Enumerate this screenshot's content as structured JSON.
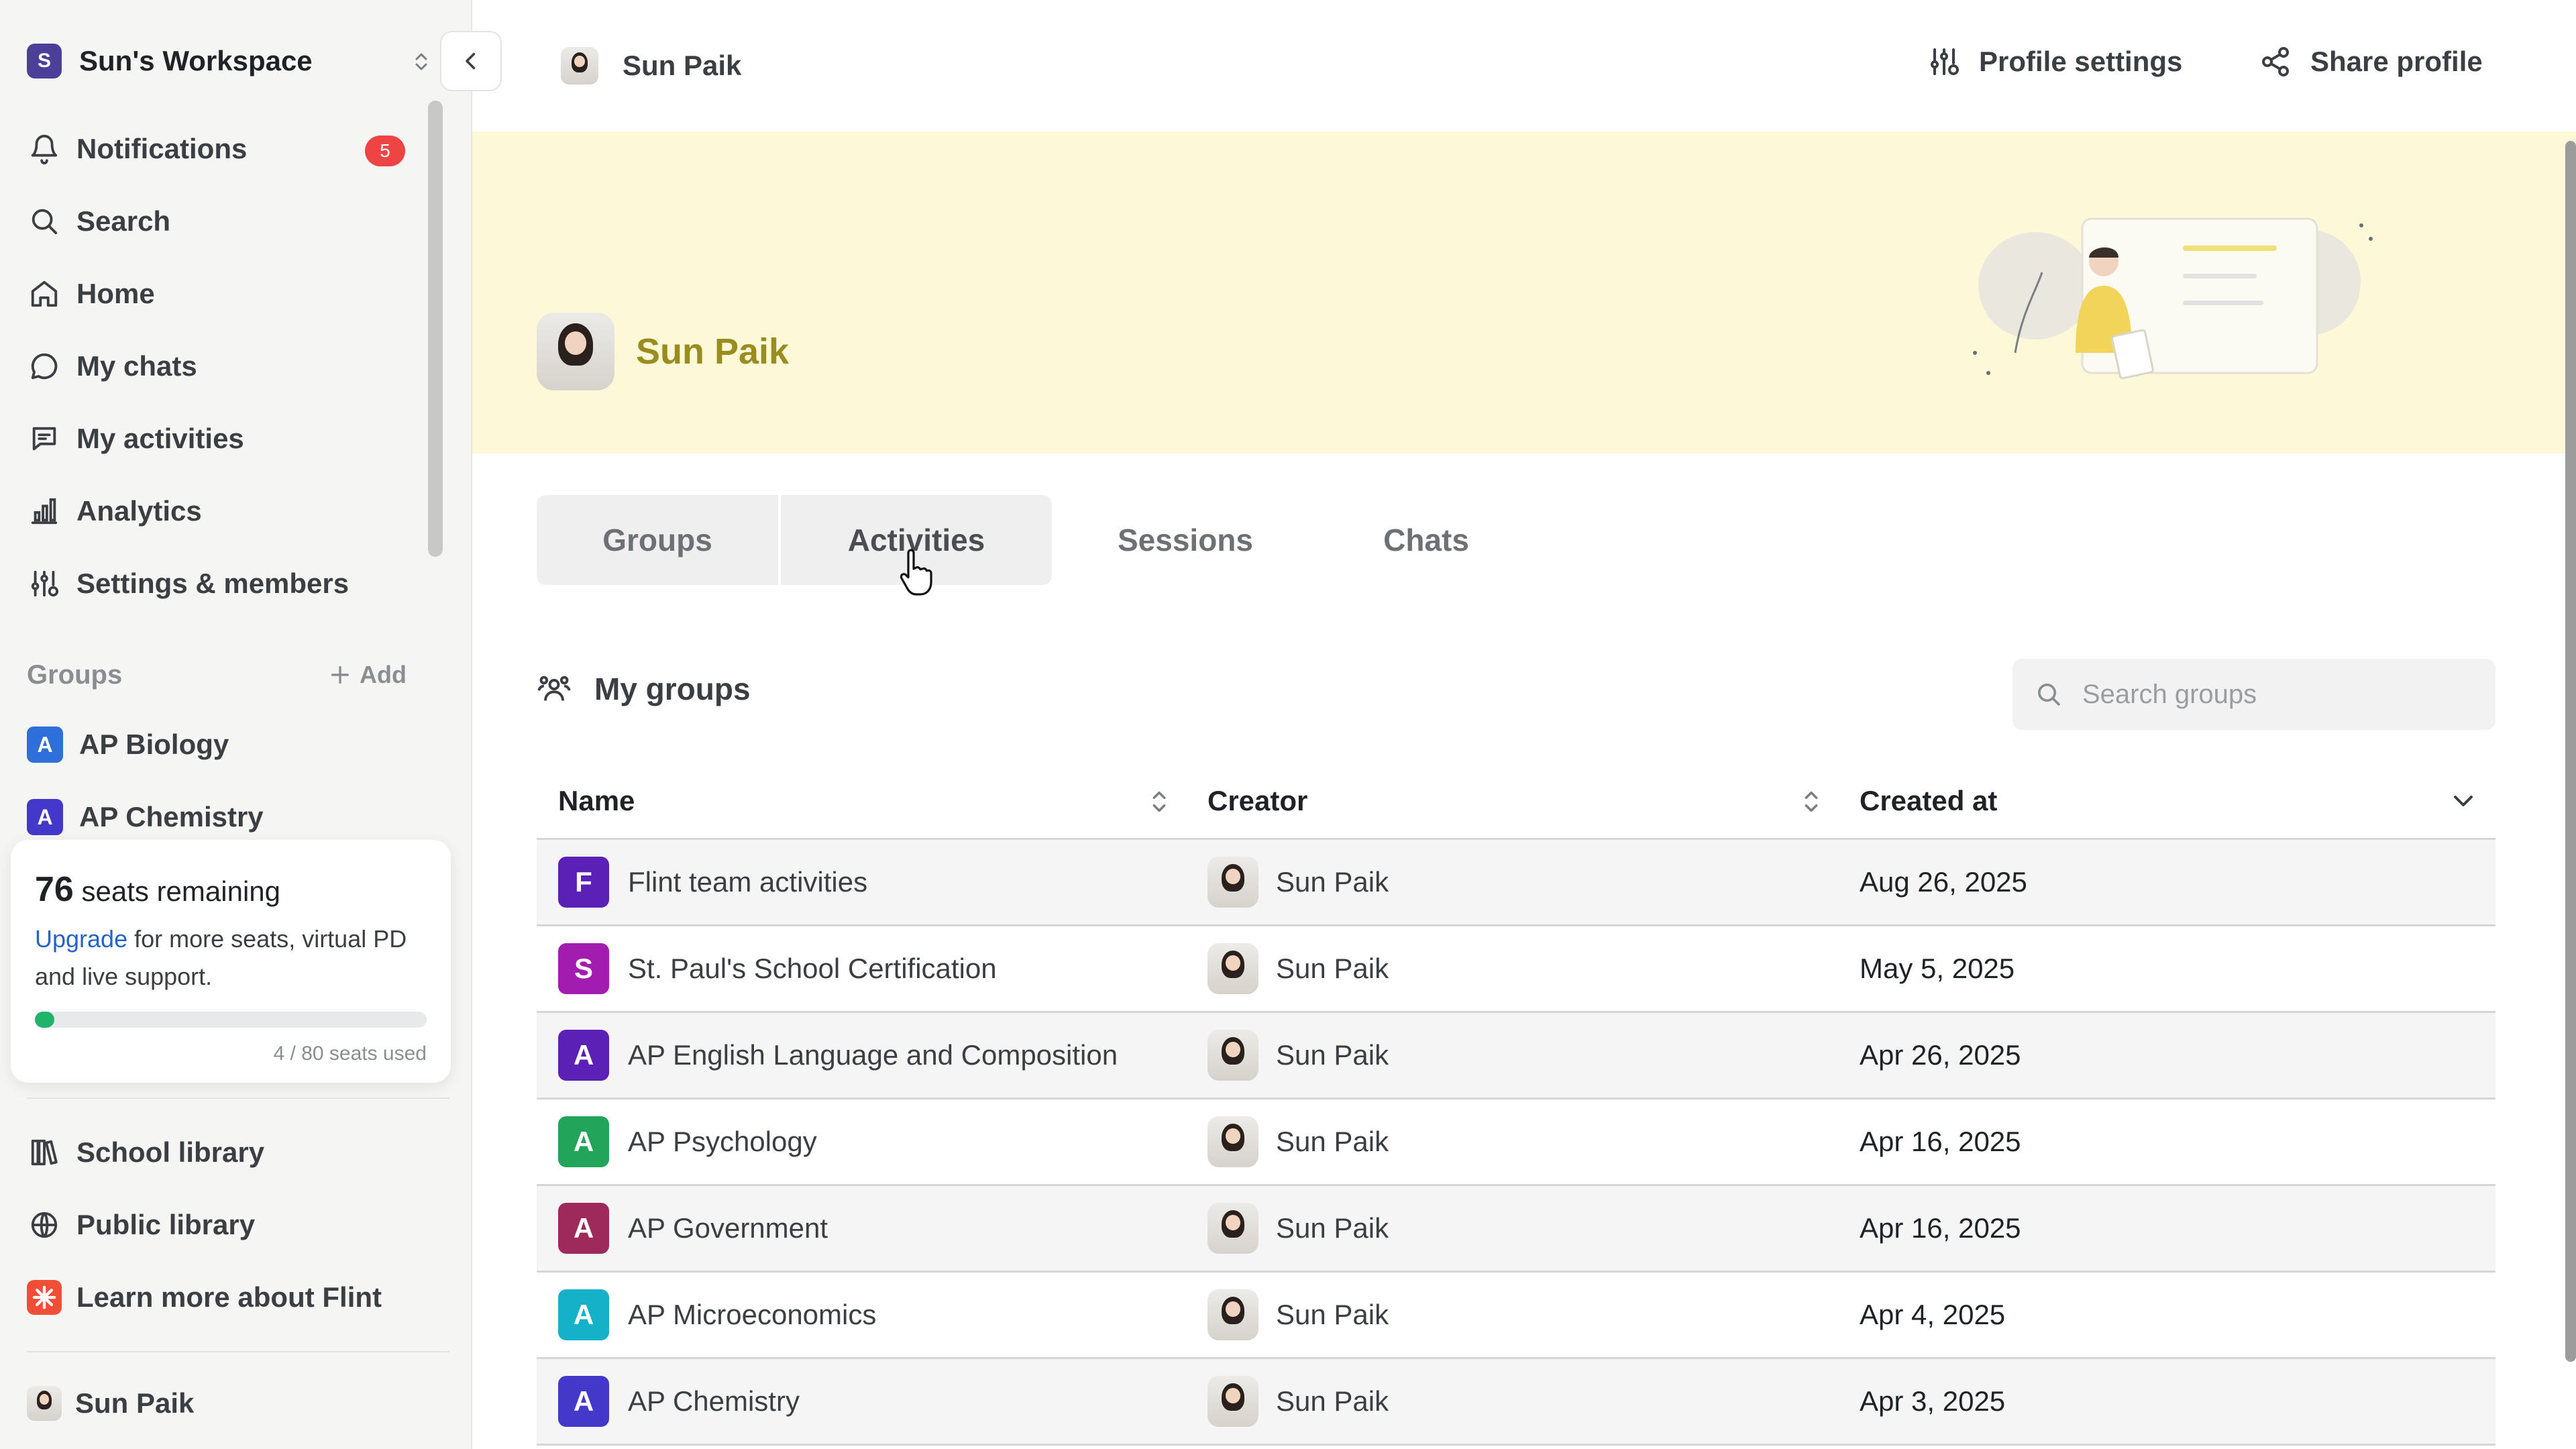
{
  "workspace": {
    "badge": "S",
    "name": "Sun's Workspace"
  },
  "nav": {
    "notifications": {
      "label": "Notifications",
      "count": "5"
    },
    "search": "Search",
    "home": "Home",
    "my_chats": "My chats",
    "my_activities": "My activities",
    "analytics": "Analytics",
    "settings": "Settings & members"
  },
  "sidebar_groups": {
    "header": "Groups",
    "add": "Add",
    "items": [
      {
        "letter": "A",
        "name": "AP Biology",
        "color": "#2f6fdb"
      },
      {
        "letter": "A",
        "name": "AP Chemistry",
        "color": "#4338ca"
      }
    ]
  },
  "seats": {
    "count": "76",
    "label": "seats remaining",
    "upgrade_link": "Upgrade",
    "upgrade_text": "for more seats, virtual PD and live support.",
    "usage_text": "4 / 80 seats used",
    "used_fraction": 0.05
  },
  "library": {
    "school": "School library",
    "public": "Public library",
    "learn": "Learn more about Flint"
  },
  "current_user": "Sun Paik",
  "topbar": {
    "user": "Sun Paik",
    "profile_settings": "Profile settings",
    "share_profile": "Share profile"
  },
  "hero": {
    "name": "Sun Paik"
  },
  "tabs": [
    "Groups",
    "Activities",
    "Sessions",
    "Chats"
  ],
  "section": {
    "title": "My groups",
    "search_placeholder": "Search groups"
  },
  "table": {
    "headers": [
      "Name",
      "Creator",
      "Created at"
    ],
    "rows": [
      {
        "letter": "F",
        "name": "Flint team activities",
        "creator": "Sun Paik",
        "date": "Aug 26, 2025",
        "color": "#5b21b6"
      },
      {
        "letter": "S",
        "name": "St. Paul's School Certification",
        "creator": "Sun Paik",
        "date": "May 5, 2025",
        "color": "#a21caf"
      },
      {
        "letter": "A",
        "name": "AP English Language and Composition",
        "creator": "Sun Paik",
        "date": "Apr 26, 2025",
        "color": "#5b21b6"
      },
      {
        "letter": "A",
        "name": "AP Psychology",
        "creator": "Sun Paik",
        "date": "Apr 16, 2025",
        "color": "#22a55a"
      },
      {
        "letter": "A",
        "name": "AP Government",
        "creator": "Sun Paik",
        "date": "Apr 16, 2025",
        "color": "#9d2a5a"
      },
      {
        "letter": "A",
        "name": "AP Microeconomics",
        "creator": "Sun Paik",
        "date": "Apr 4, 2025",
        "color": "#14b1c9"
      },
      {
        "letter": "A",
        "name": "AP Chemistry",
        "creator": "Sun Paik",
        "date": "Apr 3, 2025",
        "color": "#4338ca"
      }
    ]
  }
}
